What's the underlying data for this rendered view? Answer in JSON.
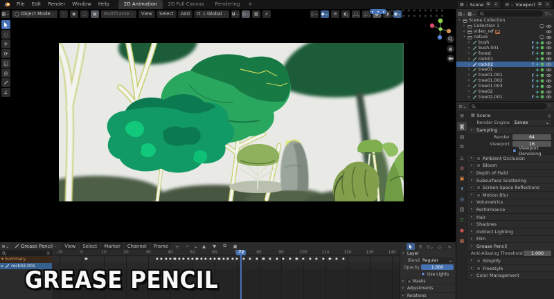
{
  "palette": {
    "accent": "#4772b3",
    "art_bg": "#e9eae6",
    "art_canopy": "#2aa75e",
    "art_canopy_dark": "#1d5c37",
    "art_teal": "#129a66",
    "art_hl": "#12c97b",
    "art_trunk": "#f3f3ef",
    "art_outline": "#c7cf6b"
  },
  "topbar": {
    "menus": [
      "File",
      "Edit",
      "Render",
      "Window",
      "Help"
    ],
    "workspaces": [
      {
        "label": "2D Animation",
        "active": true
      },
      {
        "label": "2D Full Canvas",
        "active": false
      },
      {
        "label": "Rendering",
        "active": false
      },
      {
        "label": "+",
        "active": false
      }
    ],
    "scene_field": {
      "label": "Scene"
    },
    "viewlayer_field": {
      "label": "Viewport"
    }
  },
  "viewport": {
    "header": {
      "mode": "Object Mode",
      "multiframe": "Multiframe",
      "menus": [
        "View",
        "Select",
        "Add",
        "Object"
      ],
      "orientation": "Global"
    },
    "tools": [
      {
        "name": "tweak-select-tool",
        "glyph": "cursor",
        "active": true
      },
      {
        "name": "select-circle-tool",
        "glyph": "◌",
        "active": false
      },
      {
        "name": "move-tool",
        "glyph": "✛",
        "active": false
      },
      {
        "name": "rotate-tool",
        "glyph": "⟳",
        "active": false
      },
      {
        "name": "scale-tool",
        "glyph": "◱",
        "active": false
      },
      {
        "name": "transform-tool",
        "glyph": "◎",
        "active": false
      },
      {
        "name": "annotate-tool",
        "glyph": "pen",
        "active": false
      },
      {
        "name": "measure-tool",
        "glyph": "∠",
        "active": false
      }
    ]
  },
  "outliner": {
    "rows": [
      {
        "label": "Scene Collection",
        "kind": "scene-collection",
        "depth": 0,
        "dis": "▾"
      },
      {
        "label": "Collection 1",
        "kind": "collection",
        "depth": 1,
        "dis": "▸",
        "screen": true,
        "eye": true
      },
      {
        "label": "video_ref",
        "kind": "collection-video",
        "depth": 1,
        "dis": "▸",
        "image": true,
        "eye": true
      },
      {
        "label": "nature",
        "kind": "collection",
        "depth": 1,
        "dis": "▾",
        "screen": true,
        "eye": true
      },
      {
        "label": "bush",
        "kind": "gpencil",
        "depth": 2,
        "dis": "▸",
        "badges": 3,
        "eye": true
      },
      {
        "label": "bush.001",
        "kind": "gpencil",
        "depth": 2,
        "dis": "▸",
        "badges": 3,
        "eye": true
      },
      {
        "label": "forest",
        "kind": "gpencil",
        "depth": 2,
        "dis": "▸",
        "badges": 3,
        "eye": true
      },
      {
        "label": "rock01",
        "kind": "gpencil",
        "depth": 2,
        "dis": "▸",
        "badges": 2,
        "eye": true
      },
      {
        "label": "rock02",
        "kind": "gpencil",
        "depth": 2,
        "dis": "▸",
        "badges": 3,
        "eye": true,
        "selected": true
      },
      {
        "label": "tree01",
        "kind": "gpencil",
        "depth": 2,
        "dis": "▸",
        "badges": 2,
        "eye": true
      },
      {
        "label": "tree01.001",
        "kind": "gpencil",
        "depth": 2,
        "dis": "▸",
        "badges": 3,
        "eye": true
      },
      {
        "label": "tree01.002",
        "kind": "gpencil",
        "depth": 2,
        "dis": "▸",
        "badges": 3,
        "eye": true
      },
      {
        "label": "tree01.003",
        "kind": "gpencil",
        "depth": 2,
        "dis": "▸",
        "badges": 3,
        "eye": true
      },
      {
        "label": "tree02",
        "kind": "gpencil",
        "depth": 2,
        "dis": "▸",
        "badges": 2,
        "eye": true
      },
      {
        "label": "tree02.001",
        "kind": "gpencil",
        "depth": 2,
        "dis": "▸",
        "badges": 3,
        "eye": true
      }
    ]
  },
  "properties": {
    "tabs": [
      {
        "name": "tool",
        "active": false
      },
      {
        "name": "render",
        "active": true
      },
      {
        "name": "output",
        "active": false
      },
      {
        "name": "view-layer",
        "active": false
      },
      {
        "name": "scene",
        "active": false
      },
      {
        "name": "world",
        "active": false
      },
      {
        "name": "object",
        "active": false
      },
      {
        "name": "modifiers",
        "active": false
      },
      {
        "name": "physics",
        "active": false
      },
      {
        "name": "constraints",
        "active": false
      },
      {
        "name": "object-data",
        "active": false
      },
      {
        "name": "material",
        "active": false
      },
      {
        "name": "texture",
        "active": false
      }
    ],
    "breadcrumb": "Scene",
    "render_engine": {
      "label": "Render Engine",
      "value": "Eevee"
    },
    "sampling": {
      "title": "Sampling",
      "rows": [
        {
          "label": "Render",
          "value": "64"
        },
        {
          "label": "Viewport",
          "value": "16"
        }
      ],
      "checkbox": {
        "label": "Viewport Denoising",
        "checked": true
      }
    },
    "collapsed_panels": [
      {
        "label": "Ambient Occlusion",
        "checkbox": true
      },
      {
        "label": "Bloom",
        "checkbox": true
      },
      {
        "label": "Depth of Field",
        "checkbox": false
      },
      {
        "label": "Subsurface Scattering",
        "checkbox": false
      },
      {
        "label": "Screen Space Reflections",
        "checkbox": true
      },
      {
        "label": "Motion Blur",
        "checkbox": true
      },
      {
        "label": "Volumetrics",
        "checkbox": false
      },
      {
        "label": "Performance",
        "checkbox": false
      },
      {
        "label": "Hair",
        "checkbox": false
      },
      {
        "label": "Shadows",
        "checkbox": false
      },
      {
        "label": "Indirect Lighting",
        "checkbox": false
      },
      {
        "label": "Film",
        "checkbox": false
      }
    ],
    "grease_pencil": {
      "title": "Grease Pencil",
      "aa_label": "Anti-Aliasing Threshold",
      "aa_value": "1.000"
    },
    "bottom_panels": [
      {
        "label": "Simplify",
        "checkbox": true
      },
      {
        "label": "Freestyle",
        "checkbox": true
      },
      {
        "label": "Color Management",
        "checkbox": false
      }
    ]
  },
  "dopesheet": {
    "mode": "Grease Pencil",
    "menus": [
      "View",
      "Select",
      "Marker",
      "Channel",
      "Frame"
    ],
    "channels": [
      {
        "label": "Summary",
        "type": "summary"
      },
      {
        "label": "rock02.001",
        "type": "layer",
        "selected": true
      }
    ],
    "ruler_ticks": [
      -10,
      0,
      10,
      20,
      30,
      40,
      50,
      60,
      70,
      80,
      90,
      100,
      110,
      120,
      130,
      140
    ],
    "playhead": 72,
    "keyframes": [
      2,
      34,
      36,
      38,
      40,
      42,
      44,
      46,
      48,
      50,
      52,
      54,
      56,
      58,
      60,
      62,
      64,
      66,
      68,
      70,
      73,
      76,
      79,
      82,
      85,
      88,
      91,
      94,
      97,
      100,
      103,
      106,
      109,
      112,
      115,
      118
    ],
    "sidebar": {
      "tab": "Layer",
      "blend_label": "Blend",
      "blend_value": "Regular",
      "opacity_label": "Opacity",
      "opacity_value": "1.000",
      "use_lights": {
        "label": "Use Lights",
        "checked": true
      },
      "sections": [
        {
          "label": "Masks",
          "checkbox": true
        },
        {
          "label": "Adjustments",
          "checkbox": false
        },
        {
          "label": "Relations",
          "checkbox": false
        }
      ]
    }
  },
  "caption": "GREASE PENCIL"
}
